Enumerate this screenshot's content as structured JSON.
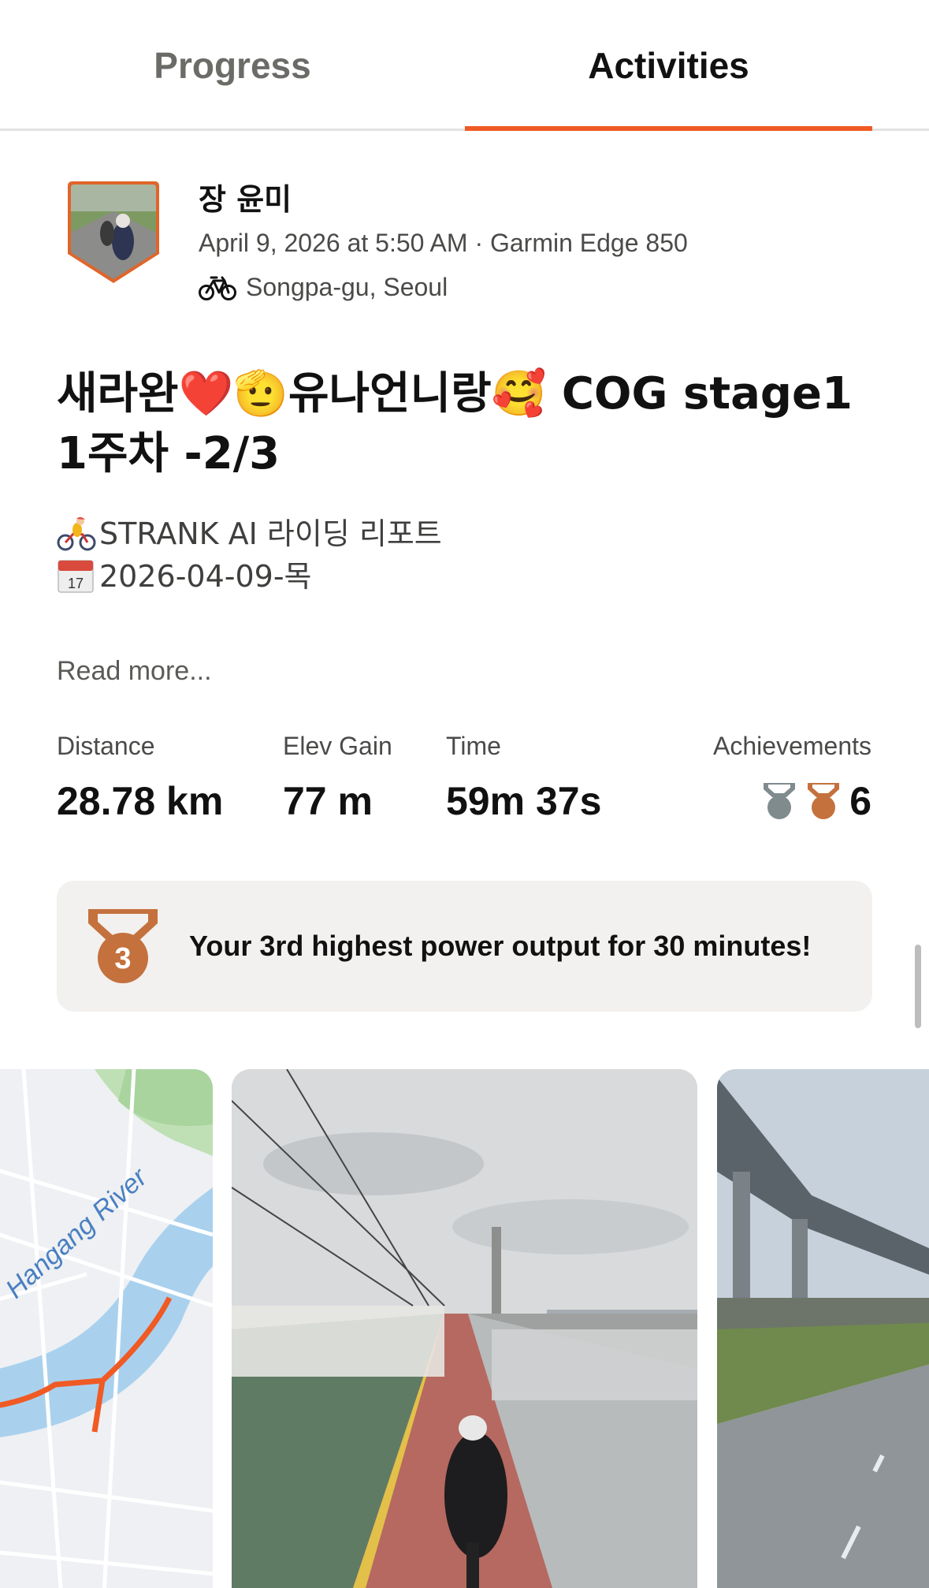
{
  "tabs": [
    {
      "label": "Progress",
      "active": false
    },
    {
      "label": "Activities",
      "active": true
    }
  ],
  "accent_color": "#f05a24",
  "activity": {
    "athlete_name": "장 윤미",
    "meta": "April 9, 2026 at 5:50 AM · Garmin Edge 850",
    "location": "Songpa-gu, Seoul",
    "location_icon": "bike-icon",
    "title": "새라완❤️🫡유나언니랑🥰 COG stage1 1주차 -2/3",
    "description": [
      {
        "icon": "cyclist-emoji-icon",
        "text": "STRANK AI 라이딩 리포트"
      },
      {
        "icon": "calendar-emoji-icon",
        "text": "2026-04-09-목"
      }
    ],
    "read_more": "Read more..."
  },
  "stats": [
    {
      "label": "Distance",
      "value": "28.78 km"
    },
    {
      "label": "Elev Gain",
      "value": "77 m"
    },
    {
      "label": "Time",
      "value": "59m 37s"
    }
  ],
  "achievements": {
    "label": "Achievements",
    "count": "6",
    "icons": [
      "silver-medal-icon",
      "bronze-medal-icon"
    ]
  },
  "banner": {
    "rank": "3",
    "text": "Your 3rd highest power output for 30 minutes!",
    "icon": "bronze-medal-icon"
  },
  "media": {
    "map_label": "Hangang River",
    "items": [
      "route-map",
      "cyclist-on-bridge-photo",
      "bike-path-under-overpass-photo"
    ]
  }
}
